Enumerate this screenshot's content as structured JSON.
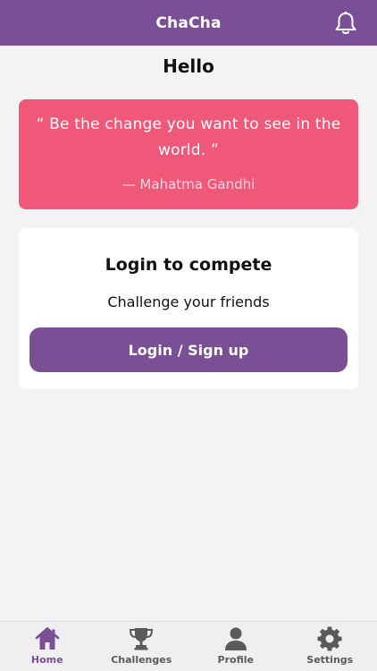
{
  "header": {
    "title": "ChaCha",
    "notification_icon": "bell-icon"
  },
  "greeting": "Hello",
  "quote": {
    "text": "“ Be the change you want to see in the world. ”",
    "author": "— Mahatma Gandhi",
    "background_color": "#f0587a"
  },
  "login_card": {
    "title": "Login to compete",
    "subtitle": "Challenge your friends",
    "button_label": "Login / Sign up"
  },
  "tabbar": {
    "active": "Home",
    "items": [
      {
        "label": "Home",
        "icon": "home-icon"
      },
      {
        "label": "Challenges",
        "icon": "trophy-icon"
      },
      {
        "label": "Profile",
        "icon": "user-icon"
      },
      {
        "label": "Settings",
        "icon": "gear-icon"
      }
    ]
  },
  "colors": {
    "brand": "#7b4f95",
    "background": "#f3f2f5",
    "quote_card": "#f0587a"
  }
}
